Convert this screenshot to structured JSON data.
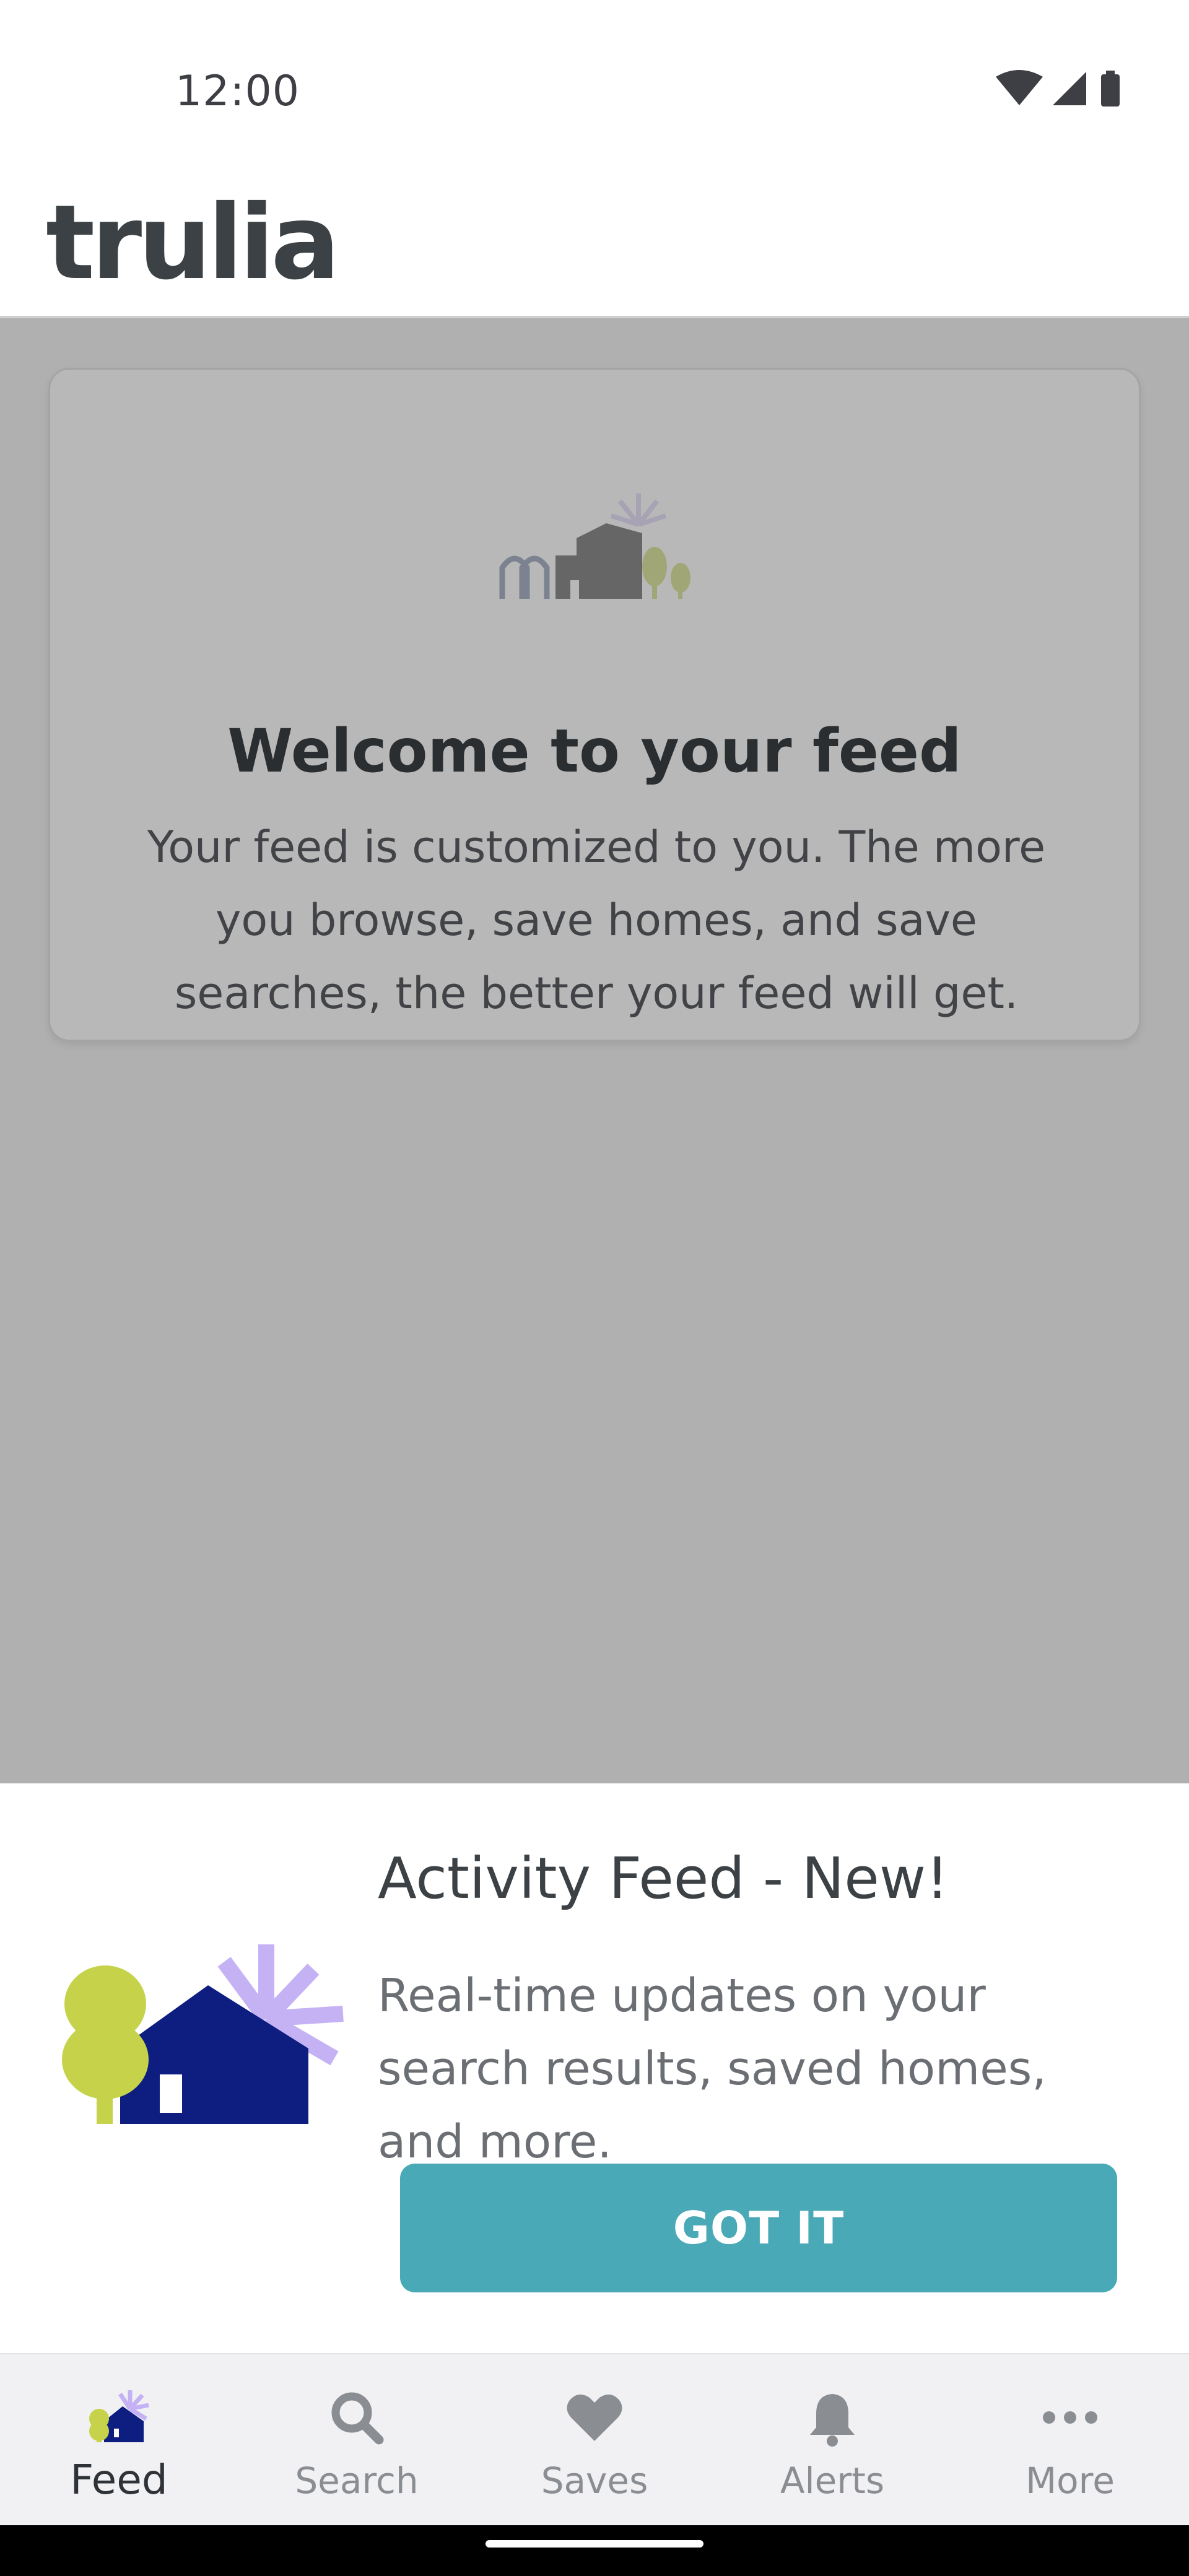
{
  "status_bar": {
    "time": "12:00",
    "icons": [
      "wifi-icon",
      "cellular-signal-icon",
      "battery-icon"
    ]
  },
  "header": {
    "logo_text": "trulia"
  },
  "feed": {
    "welcome_title": "Welcome to your feed",
    "welcome_body": "Your feed is customized to you. The more you browse, save homes, and save searches, the better your feed will get."
  },
  "sheet": {
    "title": "Activity Feed - New!",
    "body": "Real-time updates on your search results, saved homes, and more.",
    "button_label": "GOT IT"
  },
  "nav": {
    "items": [
      {
        "label": "Feed",
        "icon": "feed-house-icon",
        "active": true
      },
      {
        "label": "Search",
        "icon": "search-icon",
        "active": false
      },
      {
        "label": "Saves",
        "icon": "heart-icon",
        "active": false
      },
      {
        "label": "Alerts",
        "icon": "bell-icon",
        "active": false
      },
      {
        "label": "More",
        "icon": "more-dots-icon",
        "active": false
      }
    ]
  },
  "colors": {
    "brand_teal": "#4aa9b6",
    "navy": "#0e1e80",
    "lime": "#c6d34a",
    "lavender": "#c5b2f5",
    "text_dark": "#3b4144"
  }
}
